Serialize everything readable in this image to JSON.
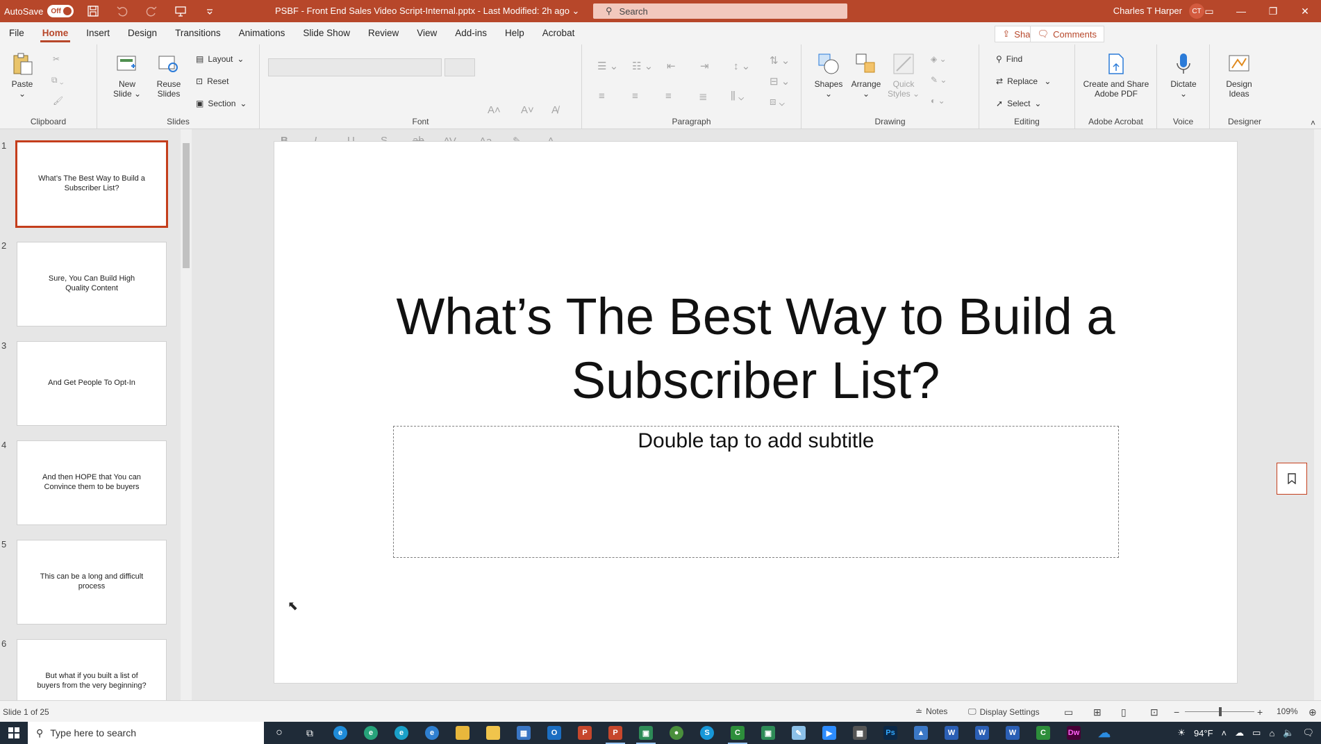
{
  "titlebar": {
    "autosave_label": "AutoSave",
    "autosave_state": "Off",
    "document_title": "PSBF - Front End Sales Video Script-Internal.pptx - Last Modified: 2h ago",
    "search_placeholder": "Search",
    "user_name": "Charles T Harper",
    "user_initials": "CT",
    "accent_color": "#b7472a"
  },
  "menu": {
    "tabs": [
      "File",
      "Home",
      "Insert",
      "Design",
      "Transitions",
      "Animations",
      "Slide Show",
      "Review",
      "View",
      "Add-ins",
      "Help",
      "Acrobat"
    ],
    "active_tab": "Home",
    "share_label": "Share",
    "comments_label": "Comments"
  },
  "ribbon": {
    "clipboard": {
      "label": "Clipboard",
      "paste": "Paste"
    },
    "slides": {
      "label": "Slides",
      "new_slide": "New Slide",
      "reuse_slides": "Reuse Slides",
      "layout": "Layout",
      "reset": "Reset",
      "section": "Section"
    },
    "font": {
      "label": "Font"
    },
    "paragraph": {
      "label": "Paragraph"
    },
    "drawing": {
      "label": "Drawing",
      "shapes": "Shapes",
      "arrange": "Arrange",
      "quick_styles": "Quick Styles"
    },
    "editing": {
      "label": "Editing",
      "find": "Find",
      "replace": "Replace",
      "select": "Select"
    },
    "adobe": {
      "label": "Adobe Acrobat",
      "create_share": "Create and Share Adobe PDF"
    },
    "voice": {
      "label": "Voice",
      "dictate": "Dictate"
    },
    "designer": {
      "label": "Designer",
      "design_ideas": "Design Ideas"
    }
  },
  "slides": [
    {
      "num": "1",
      "text": "What’s The Best Way to Build a Subscriber List?"
    },
    {
      "num": "2",
      "text": "Sure, You Can Build High Quality Content"
    },
    {
      "num": "3",
      "text": "And Get People To Opt-In"
    },
    {
      "num": "4",
      "text": "And then HOPE that You can Convince them to be buyers"
    },
    {
      "num": "5",
      "text": "This can be a long and difficult process"
    },
    {
      "num": "6",
      "text": "But what if you built a list of buyers from the very beginning?"
    }
  ],
  "current_slide": {
    "title": "What’s The Best Way to Build a Subscriber List?",
    "subtitle_placeholder": "Double tap to add subtitle"
  },
  "status": {
    "slide_counter": "Slide 1 of 25",
    "notes": "Notes",
    "display_settings": "Display Settings",
    "zoom": "109%"
  },
  "taskbar": {
    "search_placeholder": "Type here to search",
    "weather": "94°F"
  }
}
